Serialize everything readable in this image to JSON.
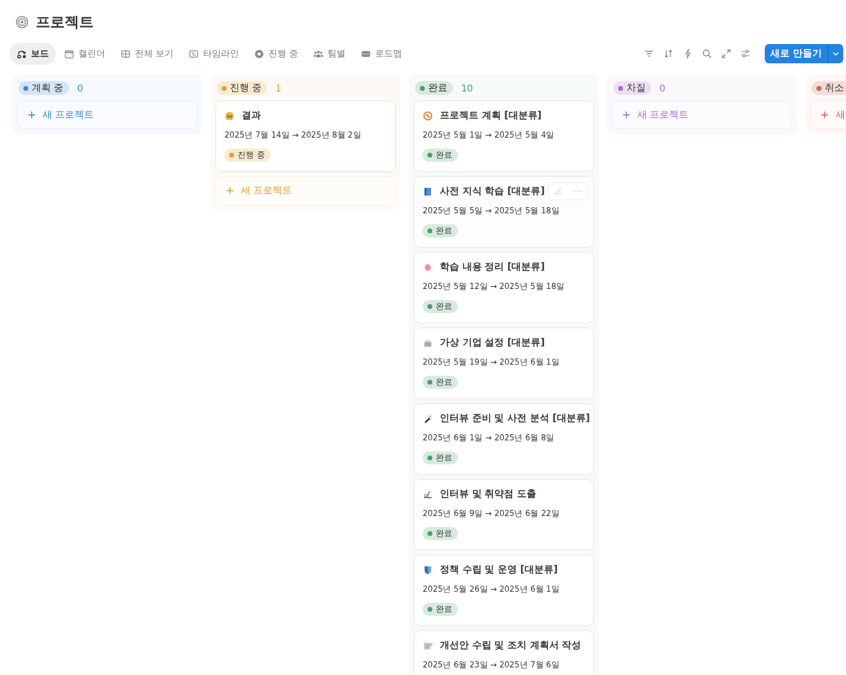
{
  "page": {
    "title": "프로젝트"
  },
  "tabs": [
    {
      "label": "보드",
      "selected": true
    },
    {
      "label": "캘린더",
      "selected": false
    },
    {
      "label": "전체 보기",
      "selected": false
    },
    {
      "label": "타임라인",
      "selected": false
    },
    {
      "label": "진행 중",
      "selected": false
    },
    {
      "label": "팀별",
      "selected": false
    },
    {
      "label": "로드맵",
      "selected": false
    }
  ],
  "new_button": {
    "label": "새로 만들기"
  },
  "columns": [
    {
      "label": "계획 중",
      "count": "0",
      "color": "#3d88d8",
      "add_label": "새 프로젝트"
    },
    {
      "label": "진행 중",
      "count": "1",
      "color": "#d9a22f",
      "add_label": "새 프로젝트",
      "cards": [
        {
          "title": "결과",
          "dates": "2025년 7월 14일 → 2025년 8월 2일",
          "status": "진행 중",
          "hovered": false
        }
      ]
    },
    {
      "label": "완료",
      "count": "10",
      "color": "#4a9e6a",
      "cards": [
        {
          "title": "프로젝트 계획 [대분류]",
          "dates": "2025년 5월 1일 → 2025년 5월 4일",
          "status": "완료",
          "hovered": false
        },
        {
          "title": "사전 지식 학습 [대분류]",
          "dates": "2025년 5월 5일 → 2025년 5월 18일",
          "status": "완료",
          "hovered": true
        },
        {
          "title": "학습 내용 정리 [대분류]",
          "dates": "2025년 5월 12일 → 2025년 5월 18일",
          "status": "완료",
          "hovered": false
        },
        {
          "title": "가상 기업 설정 [대분류]",
          "dates": "2025년 5월 19일 → 2025년 6월 1일",
          "status": "완료",
          "hovered": false
        },
        {
          "title": "인터뷰 준비 및 사전 분석 [대분류]",
          "dates": "2025년 6월 1일 → 2025년 6월 8일",
          "status": "완료",
          "hovered": false
        },
        {
          "title": "인터뷰 및 취약점 도출",
          "dates": "2025년 6월 9일 → 2025년 6월 22일",
          "status": "완료",
          "hovered": false
        },
        {
          "title": "정책 수립 및 운영 [대분류]",
          "dates": "2025년 5월 26일 → 2025년 6월 1일",
          "status": "완료",
          "hovered": false
        },
        {
          "title": "개선안 수립 및 조치 계획서 작성",
          "dates": "2025년 6월 23일 → 2025년 7월 6일",
          "hovered": false
        }
      ]
    },
    {
      "label": "차질",
      "count": "0",
      "color": "#a66ccc",
      "add_label": "새 프로젝트"
    },
    {
      "label": "취소",
      "color": "#df5b50",
      "add_label": "새"
    }
  ]
}
